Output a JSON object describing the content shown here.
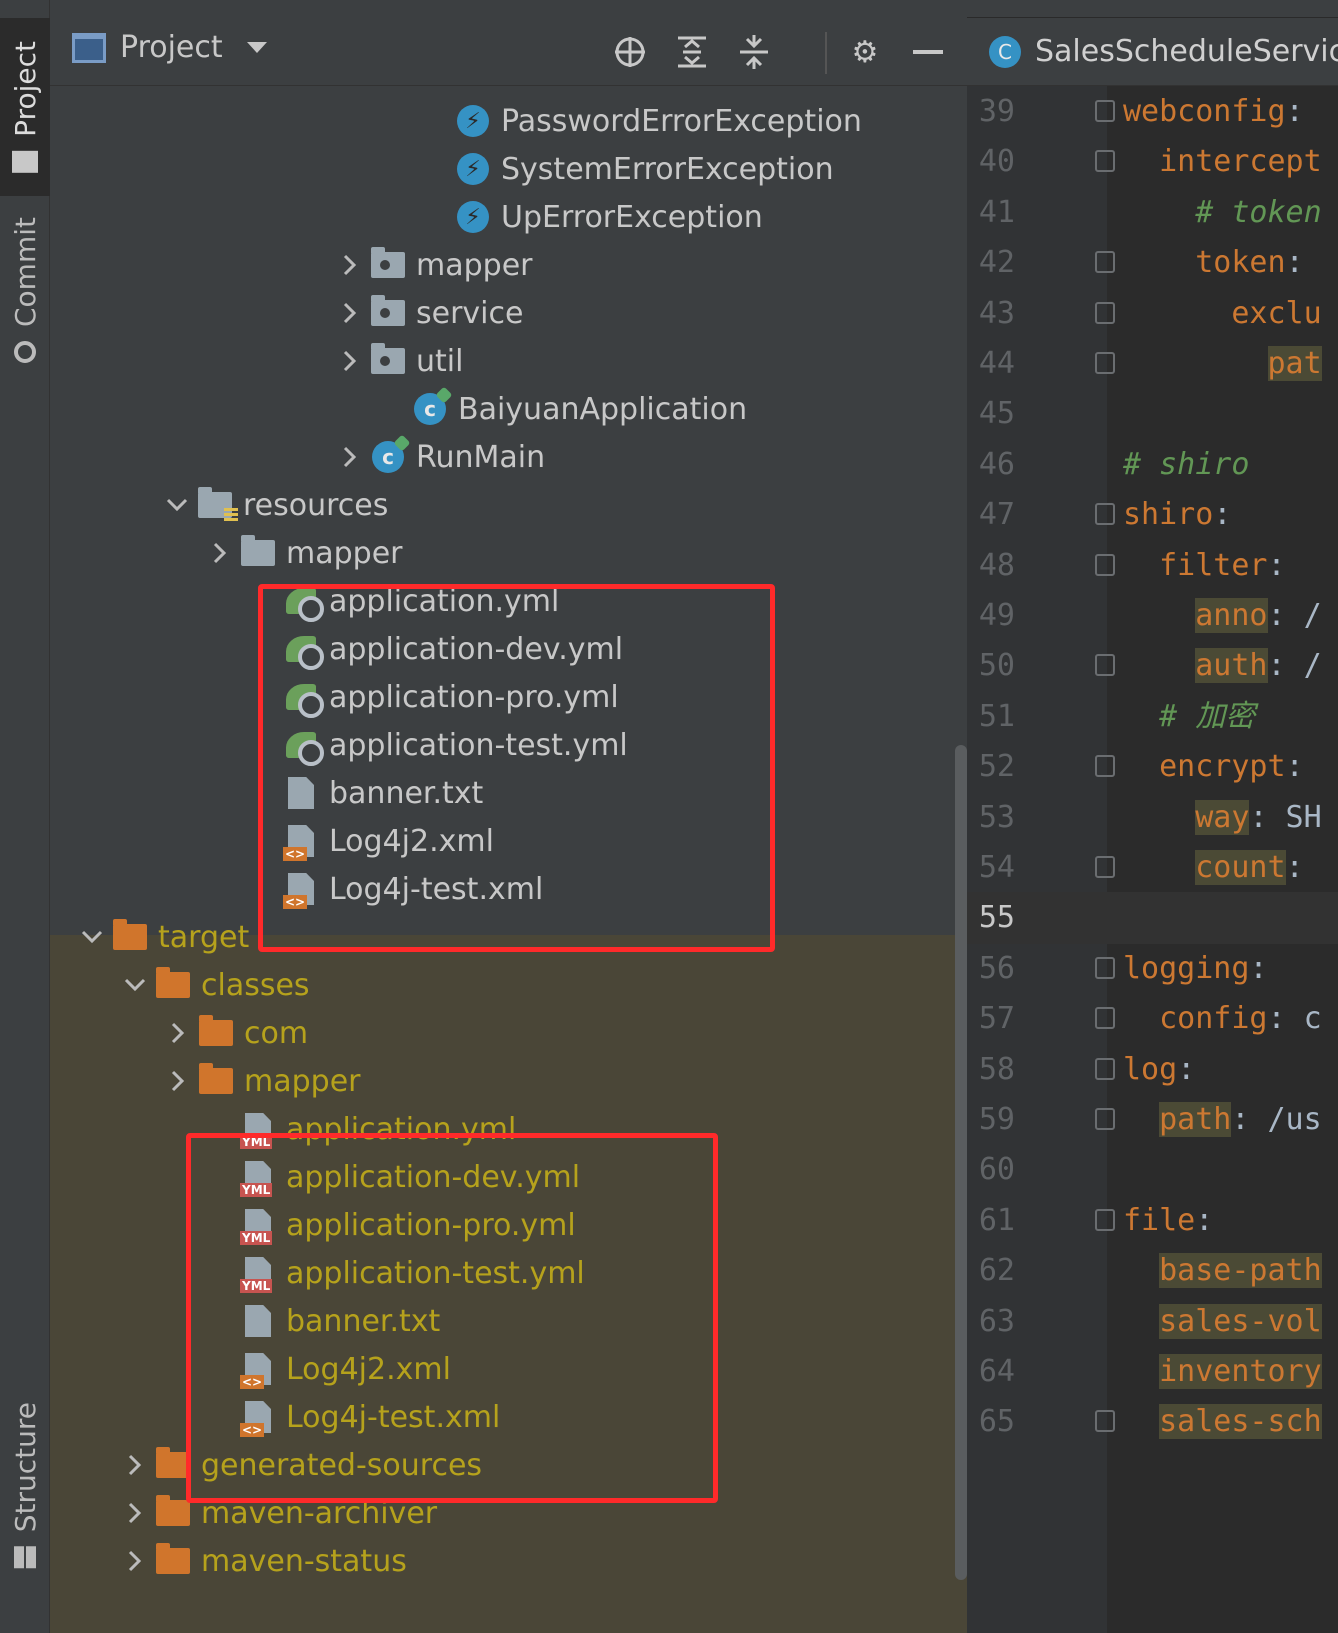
{
  "sidebar": {
    "tabs": [
      {
        "label": "Project",
        "active": true
      },
      {
        "label": "Commit"
      },
      {
        "label": "Structure"
      }
    ]
  },
  "project_panel": {
    "title": "Project",
    "toolbar_icons": [
      "locate-icon",
      "expand-all-icon",
      "collapse-all-icon",
      "gear-icon",
      "minimize-icon"
    ]
  },
  "tree": [
    {
      "label": "PasswordErrorException",
      "icon": "exception"
    },
    {
      "label": "SystemErrorException",
      "icon": "exception"
    },
    {
      "label": "UpErrorException",
      "icon": "exception"
    },
    {
      "label": "mapper",
      "icon": "package",
      "arrow": ">"
    },
    {
      "label": "service",
      "icon": "package",
      "arrow": ">"
    },
    {
      "label": "util",
      "icon": "package",
      "arrow": ">"
    },
    {
      "label": "BaiyuanApplication",
      "icon": "spring-class"
    },
    {
      "label": "RunMain",
      "icon": "class",
      "arrow": ">"
    },
    {
      "label": "resources",
      "icon": "resources-folder",
      "arrow": "v"
    },
    {
      "label": "mapper",
      "icon": "folder",
      "arrow": ">"
    },
    {
      "label": "application.yml",
      "icon": "spring-config"
    },
    {
      "label": "application-dev.yml",
      "icon": "spring-config"
    },
    {
      "label": "application-pro.yml",
      "icon": "spring-config"
    },
    {
      "label": "application-test.yml",
      "icon": "spring-config"
    },
    {
      "label": "banner.txt",
      "icon": "text-file"
    },
    {
      "label": "Log4j2.xml",
      "icon": "xml-file"
    },
    {
      "label": "Log4j-test.xml",
      "icon": "xml-file"
    },
    {
      "label": "target",
      "icon": "excluded-folder",
      "arrow": "v"
    },
    {
      "label": "classes",
      "icon": "excluded-folder",
      "arrow": "v"
    },
    {
      "label": "com",
      "icon": "excluded-folder",
      "arrow": ">"
    },
    {
      "label": "mapper",
      "icon": "excluded-folder",
      "arrow": ">"
    },
    {
      "label": "application.yml",
      "icon": "yml-file"
    },
    {
      "label": "application-dev.yml",
      "icon": "yml-file"
    },
    {
      "label": "application-pro.yml",
      "icon": "yml-file"
    },
    {
      "label": "application-test.yml",
      "icon": "yml-file"
    },
    {
      "label": "banner.txt",
      "icon": "text-file"
    },
    {
      "label": "Log4j2.xml",
      "icon": "xml-file"
    },
    {
      "label": "Log4j-test.xml",
      "icon": "xml-file"
    },
    {
      "label": "generated-sources",
      "icon": "excluded-folder",
      "arrow": ">"
    },
    {
      "label": "maven-archiver",
      "icon": "excluded-folder",
      "arrow": ">"
    },
    {
      "label": "maven-status",
      "icon": "excluded-folder",
      "arrow": ">"
    }
  ],
  "badges": {
    "yml": "YML",
    "xml": "<>"
  },
  "editor": {
    "tab_title": "SalesScheduleService",
    "tab_icon_letter": "C",
    "current_line": "55",
    "lines": [
      {
        "n": "39",
        "code": "webconfig:"
      },
      {
        "n": "40",
        "code": "  intercept"
      },
      {
        "n": "41",
        "code": "    # token"
      },
      {
        "n": "42",
        "code": "    token:"
      },
      {
        "n": "43",
        "code": "      exclu"
      },
      {
        "n": "44",
        "code": "        pat"
      },
      {
        "n": "45",
        "code": ""
      },
      {
        "n": "46",
        "code": "# shiro"
      },
      {
        "n": "47",
        "code": "shiro:"
      },
      {
        "n": "48",
        "code": "  filter:"
      },
      {
        "n": "49",
        "code": "    anno: /"
      },
      {
        "n": "50",
        "code": "    auth: /"
      },
      {
        "n": "51",
        "code": "  # 加密"
      },
      {
        "n": "52",
        "code": "  encrypt:"
      },
      {
        "n": "53",
        "code": "    way: SH"
      },
      {
        "n": "54",
        "code": "    count:"
      },
      {
        "n": "55",
        "code": ""
      },
      {
        "n": "56",
        "code": "logging:"
      },
      {
        "n": "57",
        "code": "  config: c"
      },
      {
        "n": "58",
        "code": "log:"
      },
      {
        "n": "59",
        "code": "  path: /us"
      },
      {
        "n": "60",
        "code": ""
      },
      {
        "n": "61",
        "code": "file:"
      },
      {
        "n": "62",
        "code": "  base-path"
      },
      {
        "n": "63",
        "code": "  sales-vol"
      },
      {
        "n": "64",
        "code": "  inventory"
      },
      {
        "n": "65",
        "code": "  sales-sch"
      }
    ]
  },
  "colors": {
    "highlight_box": "#ff2a2a",
    "excluded_text": "#b6a21c",
    "excluded_bg": "#4a4637"
  }
}
